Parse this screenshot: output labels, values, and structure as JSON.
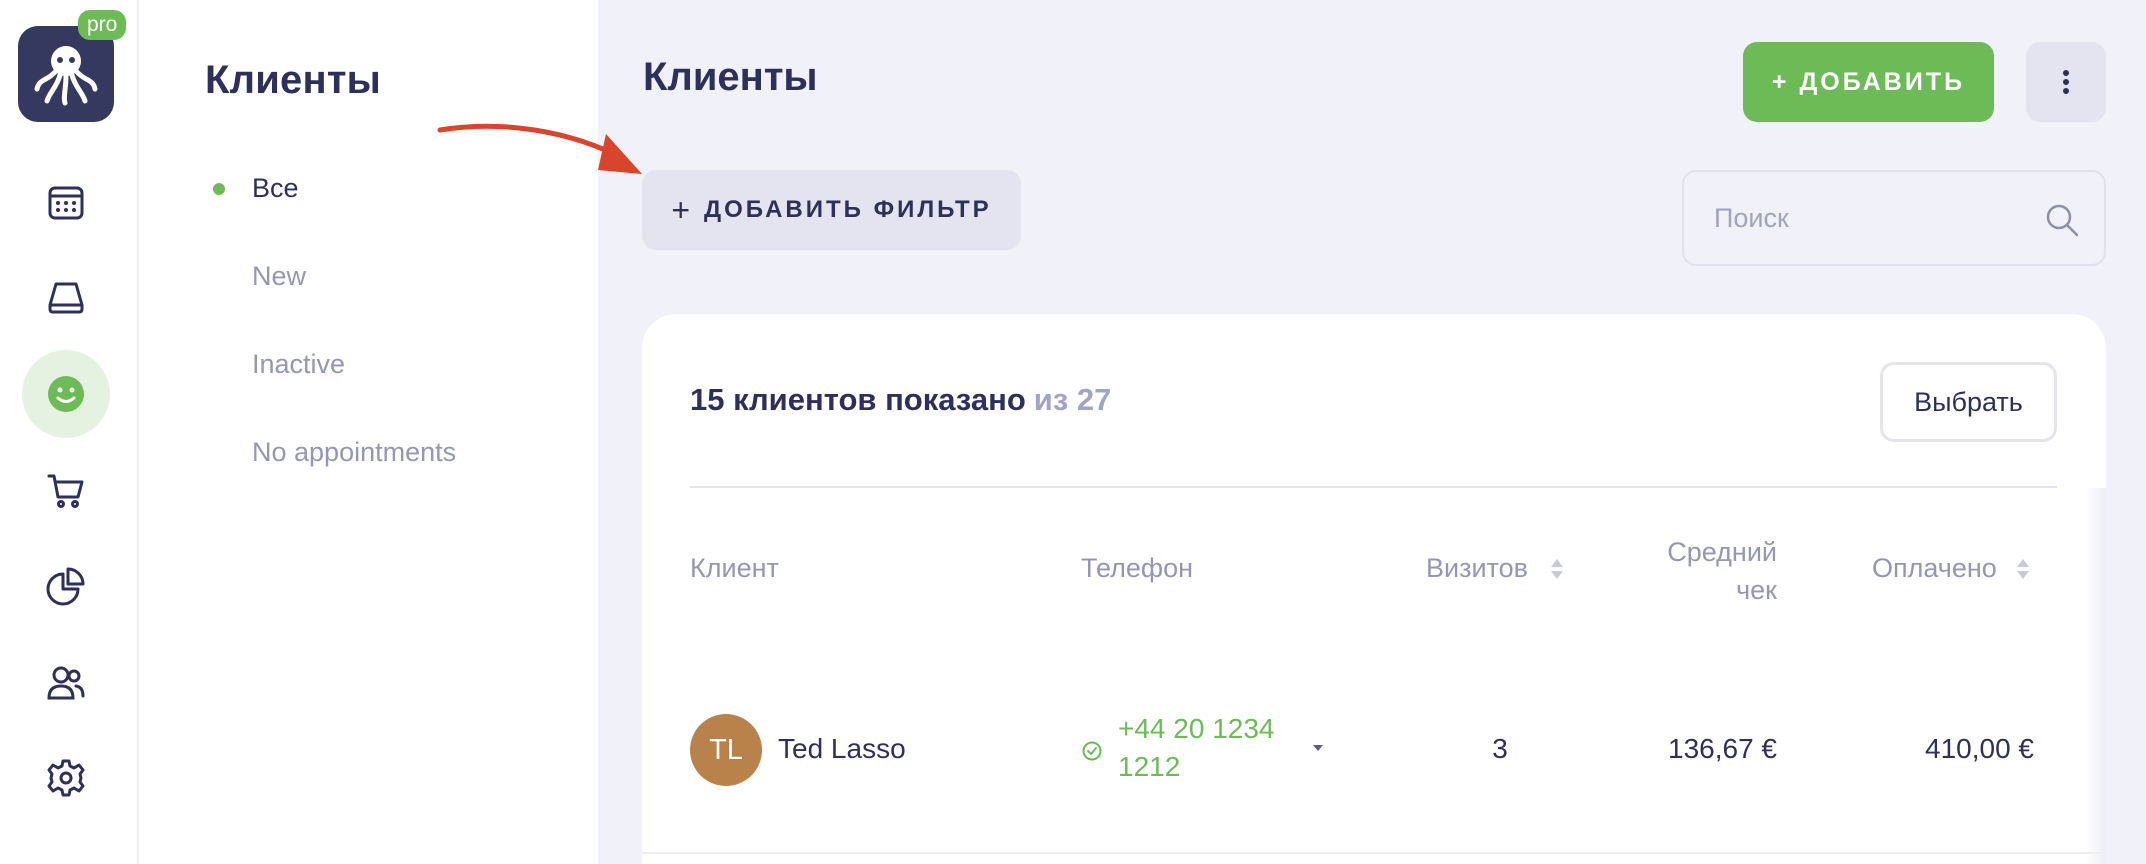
{
  "app": {
    "plan_badge": "pro",
    "colors": {
      "accent": "#6cbb57",
      "brand": "#35385f",
      "text": "#2e2f5b",
      "muted": "#9596b3"
    }
  },
  "rail": {
    "items": [
      {
        "icon": "calendar-icon",
        "active": false
      },
      {
        "icon": "inbox-icon",
        "active": false
      },
      {
        "icon": "smiley-icon",
        "active": true
      },
      {
        "icon": "cart-icon",
        "active": false
      },
      {
        "icon": "pie-chart-icon",
        "active": false
      },
      {
        "icon": "users-icon",
        "active": false
      },
      {
        "icon": "gear-icon",
        "active": false
      }
    ]
  },
  "subnav": {
    "title": "Клиенты",
    "filters": [
      "Все",
      "New",
      "Inactive",
      "No appointments"
    ],
    "active_filter": "Все"
  },
  "header": {
    "title": "Клиенты",
    "add_label": "+ ДОБАВИТЬ",
    "add_filter_plus": "+",
    "add_filter_label": "ДОБАВИТЬ ФИЛЬТР",
    "search_placeholder": "Поиск"
  },
  "clients": {
    "shown_label": "15 клиентов показано",
    "total_label": "из 27",
    "select_label": "Выбрать",
    "columns": {
      "client": "Клиент",
      "phone": "Телефон",
      "visits": "Визитов",
      "avg_check_line1": "Средний",
      "avg_check_line2": "чек",
      "paid": "Оплачено"
    },
    "rows": [
      {
        "initials": "TL",
        "name": "Ted Lasso",
        "phone_line1": "+44 20 1234",
        "phone_line2": "1212",
        "visits": "3",
        "avg_check": "136,67 €",
        "paid": "410,00 €"
      }
    ]
  }
}
